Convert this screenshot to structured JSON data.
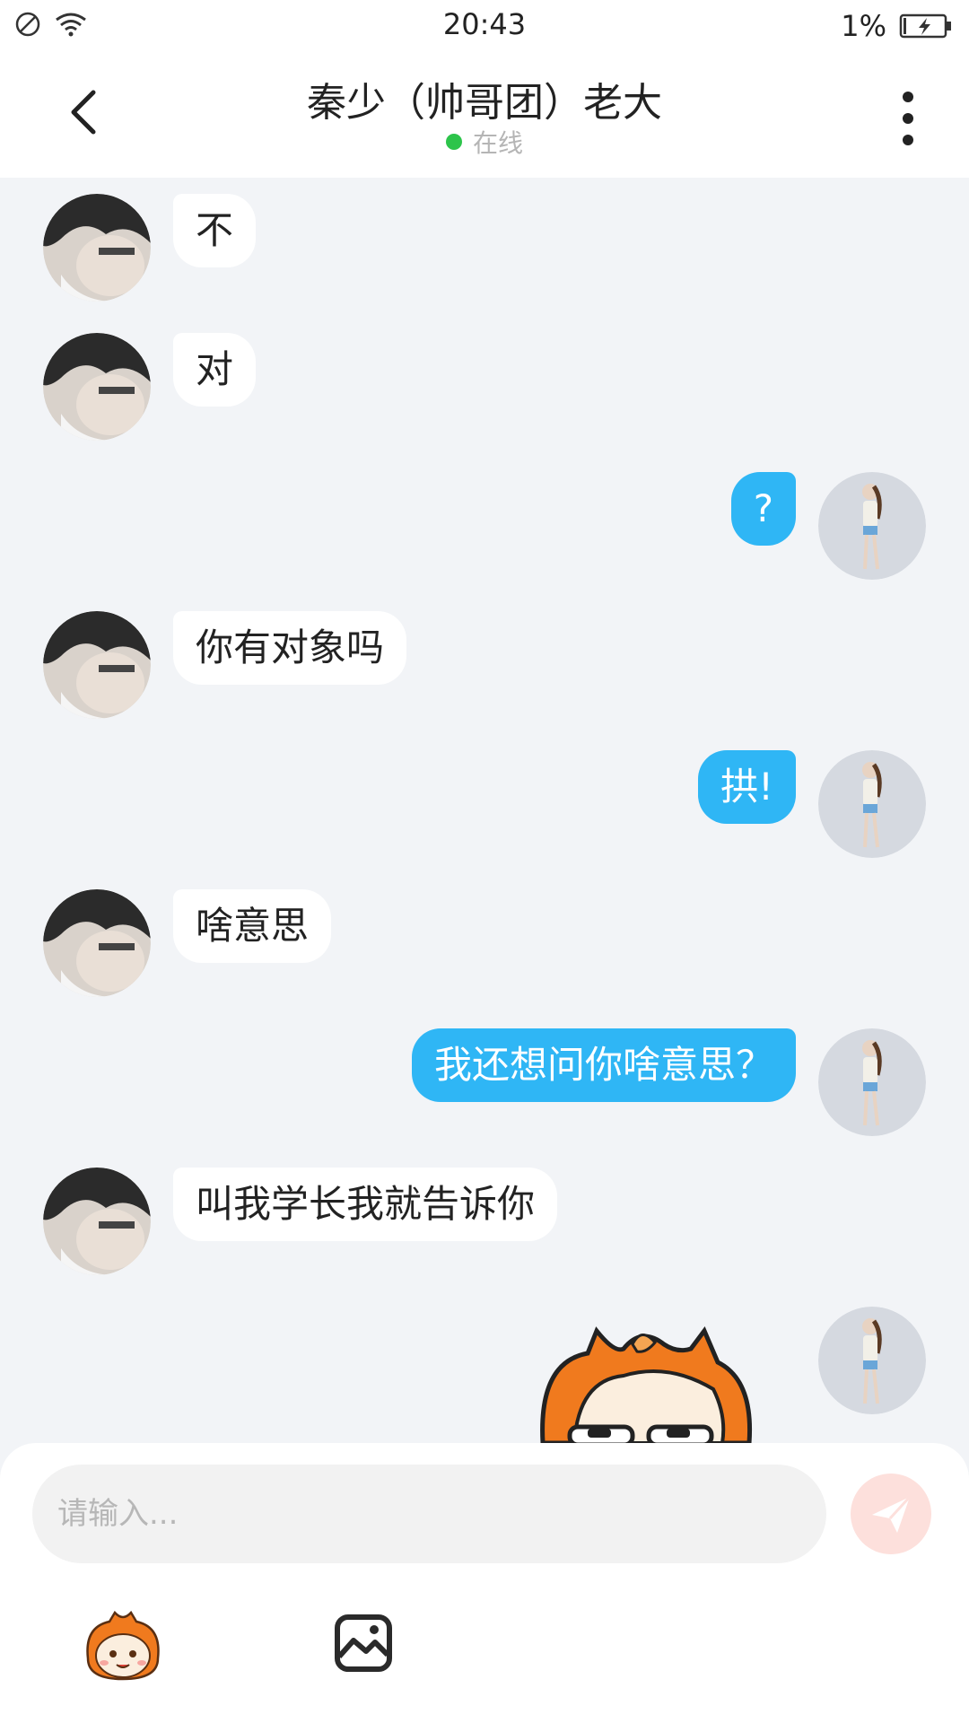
{
  "status_bar": {
    "time": "20:43",
    "battery_percent": "1%",
    "icons": [
      "do-not-disturb-icon",
      "wifi-icon",
      "battery-charging-icon"
    ]
  },
  "header": {
    "title": "秦少（帅哥团）老大",
    "status": "在线",
    "status_color": "#2dc44b",
    "back_icon": "chevron-left-icon",
    "more_icon": "more-vertical-icon"
  },
  "messages": [
    {
      "sender": "them",
      "text": "不"
    },
    {
      "sender": "them",
      "text": "对"
    },
    {
      "sender": "me",
      "text": "?"
    },
    {
      "sender": "them",
      "text": "你有对象吗"
    },
    {
      "sender": "me",
      "text": "拱!"
    },
    {
      "sender": "them",
      "text": "啥意思"
    },
    {
      "sender": "me",
      "text": "我还想问你啥意思？"
    },
    {
      "sender": "them",
      "text": "叫我学长我就告诉你"
    },
    {
      "sender": "me",
      "type": "sticker",
      "icon": "cartoon-sticker"
    }
  ],
  "composer": {
    "placeholder": "请输入...",
    "send_icon": "paper-plane-icon",
    "emoji_icon": "emoji-mascot-icon",
    "image_icon": "image-icon"
  },
  "colors": {
    "accent": "#2fb6f5",
    "background": "#f2f4f7",
    "send_button": "#fde0dc"
  }
}
